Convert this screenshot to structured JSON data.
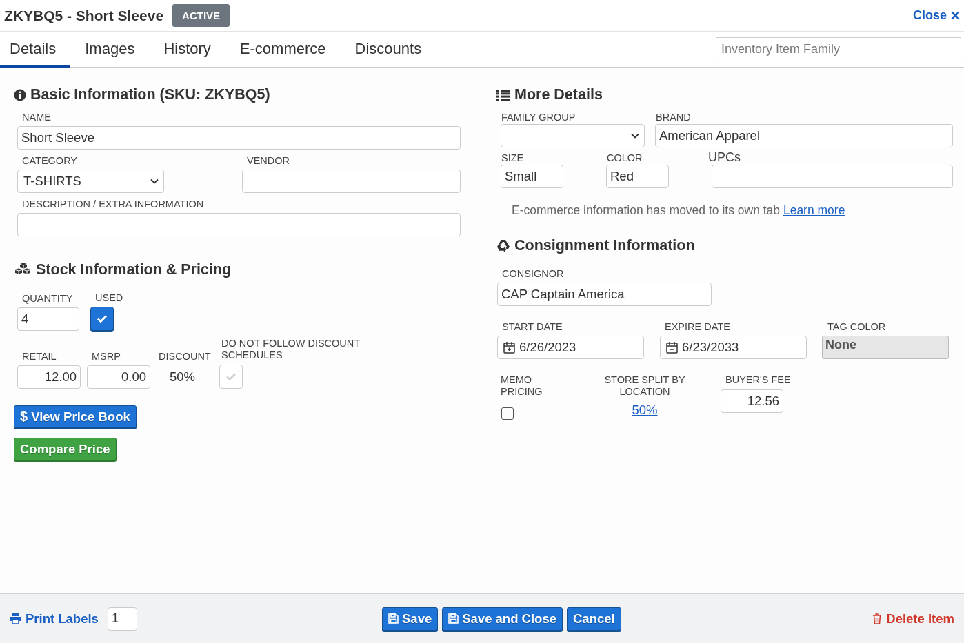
{
  "header": {
    "title": "ZKYBQ5 - Short Sleeve",
    "status_badge": "ACTIVE",
    "close_label": "Close"
  },
  "tabs": [
    {
      "label": "Details",
      "selected": true
    },
    {
      "label": "Images",
      "selected": false
    },
    {
      "label": "History",
      "selected": false
    },
    {
      "label": "E-commerce",
      "selected": false
    },
    {
      "label": "Discounts",
      "selected": false
    }
  ],
  "family_search": {
    "placeholder": "Inventory Item Family"
  },
  "basic_information": {
    "heading": "Basic Information (SKU: ZKYBQ5)",
    "name_label": "NAME",
    "name": "Short Sleeve",
    "category_label": "CATEGORY",
    "category": "T-SHIRTS",
    "vendor_label": "VENDOR",
    "description_label": "DESCRIPTION / EXTRA INFORMATION"
  },
  "stock": {
    "heading": "Stock Information & Pricing",
    "quantity_label": "QUANTITY",
    "quantity": "4",
    "used_label": "USED",
    "used_checked": true,
    "retail_label": "RETAIL",
    "retail": "12.00",
    "msrp_label": "MSRP",
    "msrp": "0.00",
    "discount_label": "DISCOUNT",
    "discount": "50%",
    "no_discount_label": "DO NOT FOLLOW DISCOUNT SCHEDULES",
    "no_discount_checked": false
  },
  "price_buttons": {
    "view_price_book": "View Price Book",
    "dollar_sign": "$",
    "compare_price": "Compare Price"
  },
  "more_details": {
    "heading": "More Details",
    "family_group_label": "FAMILY GROUP",
    "brand_label": "BRAND",
    "brand": "American Apparel",
    "size_label": "SIZE",
    "size": "Small",
    "color_label": "COLOR",
    "color_value": "Red",
    "upcs_label": "UPCs",
    "note": "E-commerce information has moved to its own tab",
    "note_link": "Learn more"
  },
  "consignment": {
    "heading": "Consignment Information",
    "consignor_label": "CONSIGNOR",
    "consignor": "CAP Captain America",
    "start_date_label": "START DATE",
    "start_date": "6/26/2023",
    "expire_date_label": "EXPIRE DATE",
    "expire_date": "6/23/2033",
    "tag_color_label": "TAG COLOR",
    "tag_color": "None",
    "memo_pricing_label": "MEMO PRICING",
    "memo_pricing_checked": false,
    "store_split_label": "STORE SPLIT BY LOCATION",
    "store_split": "50%",
    "buyers_fee_label": "BUYER'S FEE",
    "buyers_fee": "12.56"
  },
  "footer": {
    "print_labels": "Print Labels",
    "label_count": "1",
    "save": "Save",
    "save_and_close": "Save and Close",
    "cancel": "Cancel",
    "delete_item": "Delete Item"
  }
}
